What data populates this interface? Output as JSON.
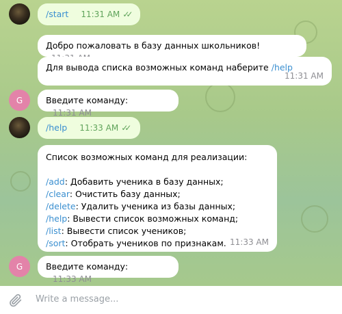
{
  "messages": [
    {
      "sender": "user",
      "text": "/start",
      "time": "11:31 AM"
    },
    {
      "sender": "bot",
      "text": "Добро пожаловать в базу данных школьников!",
      "time": "11:31 AM"
    },
    {
      "sender": "bot",
      "text_before": "Для вывода списка возможных команд наберите ",
      "command": "/help",
      "time": "11:31 AM"
    },
    {
      "sender": "bot",
      "avatar_letter": "G",
      "text": "Введите команду:",
      "time": "11:31 AM"
    },
    {
      "sender": "user",
      "text": "/help",
      "time": "11:33 AM"
    },
    {
      "sender": "bot",
      "header": "Список возможных команд для реализации:",
      "commands": [
        {
          "cmd": "/add",
          "desc": ": Добавить ученика в базу данных;"
        },
        {
          "cmd": "/clear",
          "desc": ": Очистить базу данных;"
        },
        {
          "cmd": "/delete",
          "desc": ": Удалить ученика из базы данных;"
        },
        {
          "cmd": "/help",
          "desc": ": Вывести список возможных команд;"
        },
        {
          "cmd": "/list",
          "desc": ": Вывести список учеников;"
        },
        {
          "cmd": "/sort",
          "desc": ": Отобрать учеников по признакам."
        }
      ],
      "time": "11:33 AM"
    },
    {
      "sender": "bot",
      "avatar_letter": "G",
      "text": "Введите команду:",
      "time": "11:33 AM"
    }
  ],
  "input": {
    "placeholder": "Write a message..."
  },
  "colors": {
    "outgoing_bubble": "#effdde",
    "incoming_bubble": "#ffffff",
    "link": "#3a8fd0",
    "bot_avatar": "#e383a9",
    "check": "#5fa35a"
  },
  "icons": {
    "attach": "paperclip-icon",
    "read_receipt": "double-check-icon"
  }
}
